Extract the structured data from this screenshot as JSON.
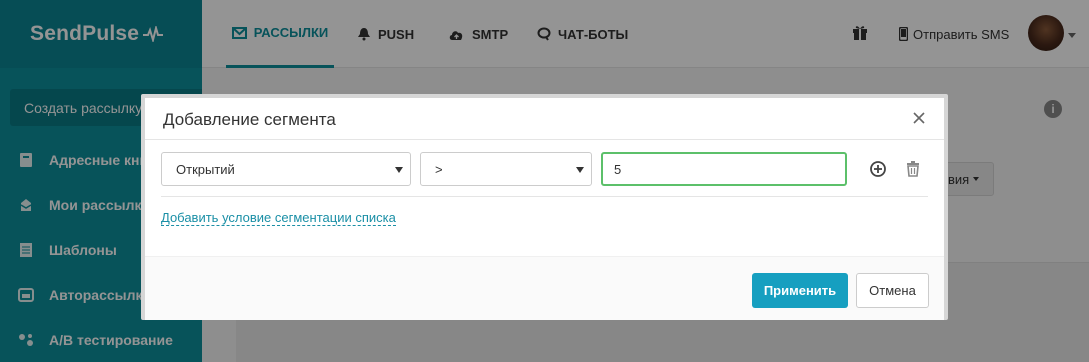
{
  "app": {
    "logo": "SendPulse",
    "create_button": "Создать рассылку",
    "sidebar": {
      "items": [
        {
          "label": "Адресные книги",
          "icon": "address-book-icon"
        },
        {
          "label": "Мои рассылки",
          "icon": "campaigns-icon"
        },
        {
          "label": "Шаблоны",
          "icon": "templates-icon"
        },
        {
          "label": "Авторассылки",
          "icon": "automation-icon"
        },
        {
          "label": "A/B тестирование",
          "icon": "ab-test-icon"
        }
      ]
    },
    "topnav": {
      "items": [
        {
          "label": "РАССЫЛКИ",
          "icon": "envelope-icon",
          "active": true
        },
        {
          "label": "PUSH",
          "icon": "bell-icon",
          "active": false
        },
        {
          "label": "SMTP",
          "icon": "cloud-upload-icon",
          "active": false
        },
        {
          "label": "ЧАТ-БОТЫ",
          "icon": "chat-icon",
          "active": false
        }
      ],
      "send_sms": "Отправить SMS"
    },
    "background_dropdown": "вия"
  },
  "modal": {
    "title": "Добавление сегмента",
    "condition": {
      "field": "Открытий",
      "operator": ">",
      "value": "5"
    },
    "add_condition_link": "Добавить условие сегментации списка",
    "apply_button": "Применить",
    "cancel_button": "Отмена"
  },
  "colors": {
    "brand": "#0d8f9c",
    "primary_button": "#169fc0",
    "input_focus": "#5cc06a"
  }
}
